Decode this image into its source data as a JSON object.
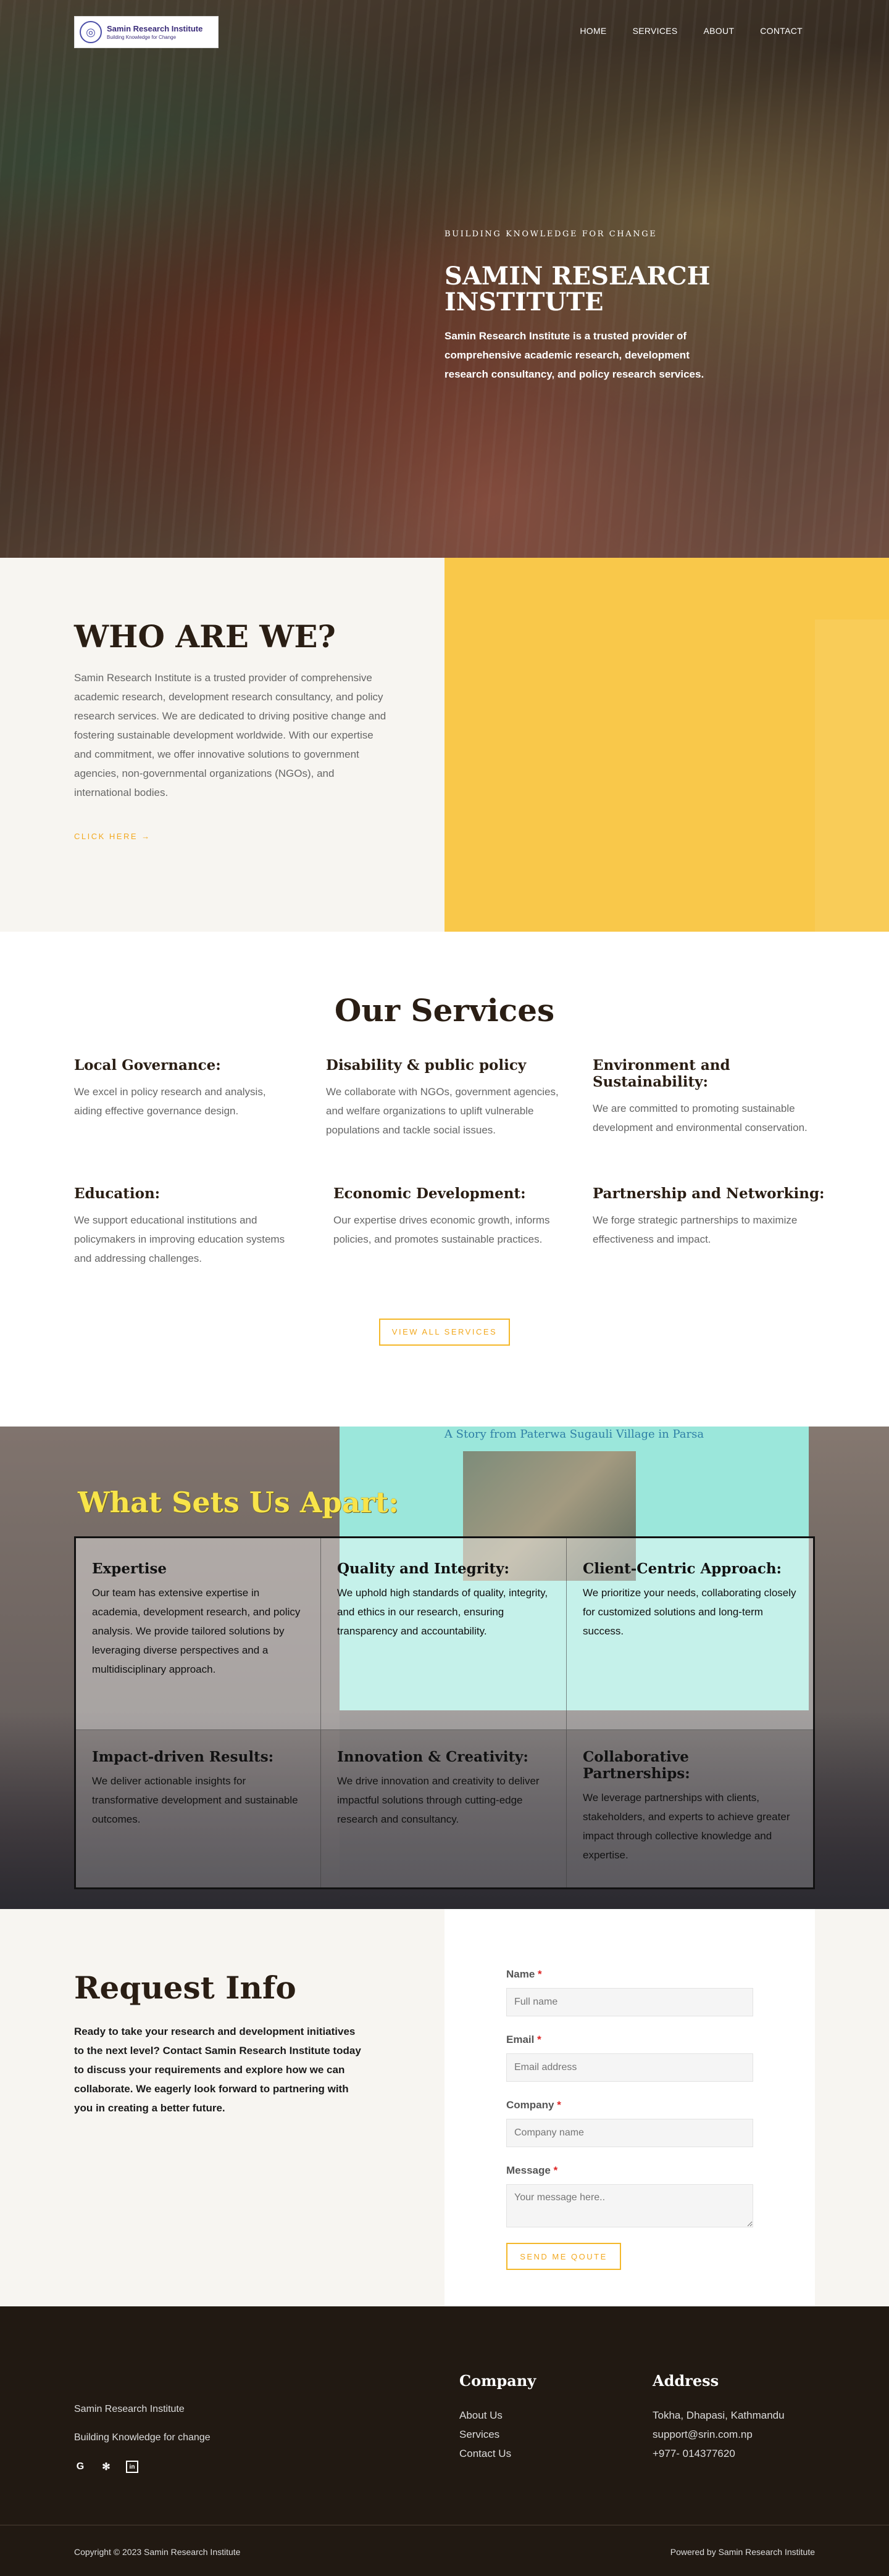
{
  "header": {
    "logo_name": "Samin Research Institute",
    "logo_tagline": "Building Knowledge for Change",
    "nav": [
      {
        "label": "HOME"
      },
      {
        "label": "SERVICES"
      },
      {
        "label": "ABOUT"
      },
      {
        "label": "CONTACT"
      }
    ]
  },
  "hero": {
    "kicker": "BUILDING KNOWLEDGE FOR CHANGE",
    "title_line1": "SAMIN RESEARCH",
    "title_line2": "INSTITUTE",
    "description": "Samin Research Institute is a trusted provider of comprehensive academic research, development research consultancy, and policy research services."
  },
  "who": {
    "title": "WHO ARE WE?",
    "text": "Samin Research Institute is a trusted provider of comprehensive academic research, development research consultancy, and policy research services. We are dedicated to driving positive change and fostering sustainable development worldwide. With our expertise and commitment, we offer innovative solutions to government agencies, non-governmental organizations (NGOs), and international bodies.",
    "link": "CLICK HERE →"
  },
  "services": {
    "title": "Our Services",
    "items": [
      {
        "title": "Local Governance:",
        "text": "We excel in policy research and analysis, aiding effective governance design."
      },
      {
        "title": "Disability & public policy",
        "text": "We collaborate with NGOs, government agencies, and welfare organizations to uplift vulnerable populations and tackle social issues."
      },
      {
        "title": "Environment and Sustainability:",
        "text": "We are committed to promoting sustainable development and environmental conservation."
      },
      {
        "title": "Education:",
        "text": "We support educational institutions and policymakers in improving education systems and addressing challenges."
      },
      {
        "title": "Economic Development:",
        "text": "Our expertise drives economic growth, informs policies, and promotes sustainable practices."
      },
      {
        "title": "Partnership and Networking:",
        "text": "We forge strategic partnerships to maximize effectiveness and impact."
      }
    ],
    "view_all": "VIEW ALL SERVICES"
  },
  "apart": {
    "screen_caption": "A Story from Paterwa Sugauli Village in Parsa",
    "title": "What Sets Us Apart:",
    "items": [
      {
        "title": "Expertise",
        "text": "Our team has extensive expertise in academia, development research, and policy analysis. We provide tailored solutions by leveraging diverse perspectives and a multidisciplinary approach."
      },
      {
        "title": "Quality and Integrity:",
        "text": "We uphold high standards of quality, integrity, and ethics in our research, ensuring transparency and accountability."
      },
      {
        "title": "Client-Centric Approach:",
        "text": "We prioritize your needs, collaborating closely for customized solutions and long-term success."
      },
      {
        "title": "Impact-driven Results:",
        "text": "We deliver actionable insights for transformative development and sustainable outcomes."
      },
      {
        "title": "Innovation & Creativity:",
        "text": "We drive innovation and creativity to deliver impactful solutions through cutting-edge research and consultancy."
      },
      {
        "title": "Collaborative Partnerships:",
        "text": "We leverage partnerships with clients, stakeholders, and experts to achieve greater impact through collective knowledge and expertise."
      }
    ]
  },
  "request": {
    "title": "Request Info",
    "text": "Ready to take your research and development initiatives to the next level? Contact Samin Research Institute today to discuss your requirements and explore how we can collaborate. We eagerly look forward to partnering with you in creating a better future.",
    "form": {
      "name_label": "Name",
      "name_placeholder": "Full name",
      "email_label": "Email",
      "email_placeholder": "Email address",
      "company_label": "Company",
      "company_placeholder": "Company name",
      "message_label": "Message",
      "message_placeholder": "Your message here..",
      "required_mark": "*",
      "submit": "SEND ME QOUTE"
    }
  },
  "footer": {
    "brand": "Samin Research Institute",
    "tagline": "Building Knowledge for change",
    "social": [
      {
        "icon": "google-icon",
        "glyph": "G"
      },
      {
        "icon": "yelp-icon",
        "glyph": "✻"
      },
      {
        "icon": "linkedin-icon",
        "glyph": "in"
      }
    ],
    "company_title": "Company",
    "company_links": [
      {
        "label": "About Us"
      },
      {
        "label": "Services"
      },
      {
        "label": "Contact Us"
      }
    ],
    "address_title": "Address",
    "address_lines": [
      {
        "text": "Tokha, Dhapasi, Kathmandu"
      },
      {
        "text": "support@srin.com.np"
      },
      {
        "text": "+977- 014377620"
      }
    ],
    "copyright": "Copyright © 2023 Samin Research Institute",
    "powered": "Powered by Samin Research Institute"
  },
  "colors": {
    "accent": "#f9c84a",
    "accent_text": "#f2a81e",
    "dark": "#2a1e14",
    "footer_bg": "#211912"
  }
}
